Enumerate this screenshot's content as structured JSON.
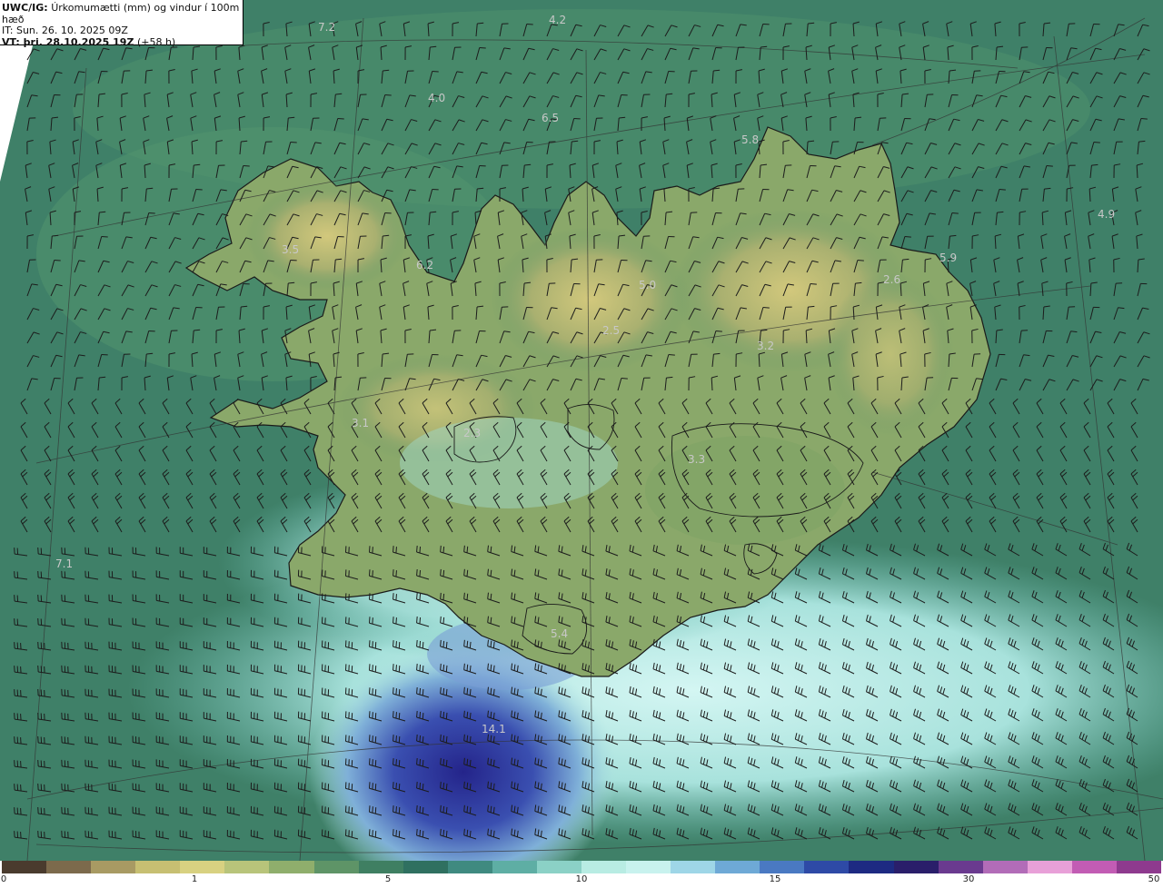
{
  "header": {
    "model_prefix": "UWC/IG:",
    "title": "Úrkomumætti (mm) og vindur í 100m hæð",
    "initial_time": "IT: Sun. 26. 10. 2025 09Z",
    "valid_prefix": "VT: þri. 28.10.2025 19Z",
    "valid_offset": "(+58 h)"
  },
  "colorbar": {
    "ticks": [
      "0",
      "1",
      "5",
      "10",
      "15",
      "30",
      "50"
    ],
    "colors": [
      "#4a3b2e",
      "#7c6a4c",
      "#a89a63",
      "#c7bf72",
      "#d8d181",
      "#b8c47a",
      "#8fae6c",
      "#5e9467",
      "#3f7f62",
      "#2f7060",
      "#3f8a80",
      "#5eaea4",
      "#8bd1c6",
      "#b8ece3",
      "#c8f2ee",
      "#9ed6e7",
      "#6ea9d6",
      "#4a79c2",
      "#2e4aa6",
      "#1d2a82",
      "#2a1e6a",
      "#6a3a8f",
      "#b26cb8",
      "#e8a0d8",
      "#c25cb4",
      "#8e3a8e"
    ]
  },
  "map": {
    "precip_labels": [
      "7.2",
      "4.2",
      "4.0",
      "6.5",
      "5.8",
      "4.9",
      "5.9",
      "6.2",
      "5.0",
      "2.6",
      "2.5",
      "3.2",
      "3.3",
      "7.1",
      "5.4",
      "14.1",
      "3.5",
      "3.1",
      "2.3"
    ]
  }
}
